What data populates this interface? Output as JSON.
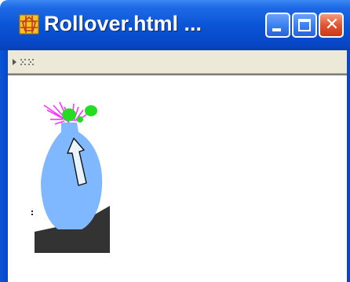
{
  "window": {
    "title": "Rollover.html ...",
    "app_icon": "pentagon-web-icon",
    "buttons": {
      "minimize_icon": "minimize-icon",
      "maximize_icon": "maximize-icon",
      "close_icon": "close-icon"
    }
  },
  "toolbar": {
    "grip_icon": "toolbar-grip-icon"
  },
  "content": {
    "image": "rollover-vase-image",
    "cursor_icon": "arrow-cursor-icon"
  },
  "colors": {
    "titlebar": "#0a55d6",
    "close_button": "#e2552f",
    "vase": "#80b8ff",
    "flowers": "#22dd22",
    "stems": "#ff33ff",
    "shadow": "#333333",
    "toolbar": "#ece9d8"
  }
}
